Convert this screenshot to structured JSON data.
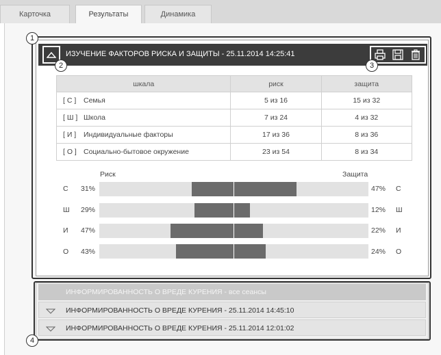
{
  "tabs": [
    {
      "label": "Карточка"
    },
    {
      "label": "Результаты"
    },
    {
      "label": "Динамика"
    }
  ],
  "panel": {
    "title": "ИЗУЧЕНИЕ ФАКТОРОВ РИСКА И ЗАЩИТЫ - 25.11.2014  14:25:41",
    "collapse_icon": "chevron-up-icon",
    "toolbar_icons": [
      "print-icon",
      "save-icon",
      "delete-icon"
    ]
  },
  "table": {
    "headers": [
      "шкала",
      "риск",
      "защита"
    ],
    "rows": [
      {
        "code": "[ С ]",
        "name": "Семья",
        "risk": "5 из 16",
        "protect": "15 из 32"
      },
      {
        "code": "[ Ш ]",
        "name": "Школа",
        "risk": "7 из 24",
        "protect": "4 из 32"
      },
      {
        "code": "[ И ]",
        "name": "Индивидуальные факторы",
        "risk": "17 из 36",
        "protect": "8 из 36"
      },
      {
        "code": "[ О ]",
        "name": "Социально-бытовое окружение",
        "risk": "23 из 54",
        "protect": "8 из 34"
      }
    ]
  },
  "chart": {
    "left_label": "Риск",
    "right_label": "Защита",
    "rows": [
      {
        "code": "С",
        "risk": "31%",
        "protect": "47%",
        "risk_value": 31,
        "protect_value": 47
      },
      {
        "code": "Ш",
        "risk": "29%",
        "protect": "12%",
        "risk_value": 29,
        "protect_value": 12
      },
      {
        "code": "И",
        "risk": "47%",
        "protect": "22%",
        "risk_value": 47,
        "protect_value": 22
      },
      {
        "code": "О",
        "risk": "43%",
        "protect": "24%",
        "risk_value": 43,
        "protect_value": 24
      }
    ]
  },
  "sessions": {
    "all_label": "ИНФОРМИРОВАННОСТЬ О ВРЕДЕ КУРЕНИЯ - все сеансы",
    "items": [
      {
        "label": "ИНФОРМИРОВАННОСТЬ О ВРЕДЕ КУРЕНИЯ - 25.11.2014  14:45:10"
      },
      {
        "label": "ИНФОРМИРОВАННОСТЬ О ВРЕДЕ КУРЕНИЯ - 25.11.2014  12:01:02"
      }
    ],
    "expand_icon": "chevron-down-icon"
  },
  "callouts": [
    "1",
    "2",
    "3",
    "4"
  ],
  "colors": {
    "header_bg": "#3c3c3c",
    "bar": "#6b6b6b",
    "track": "#e2e2e2"
  }
}
